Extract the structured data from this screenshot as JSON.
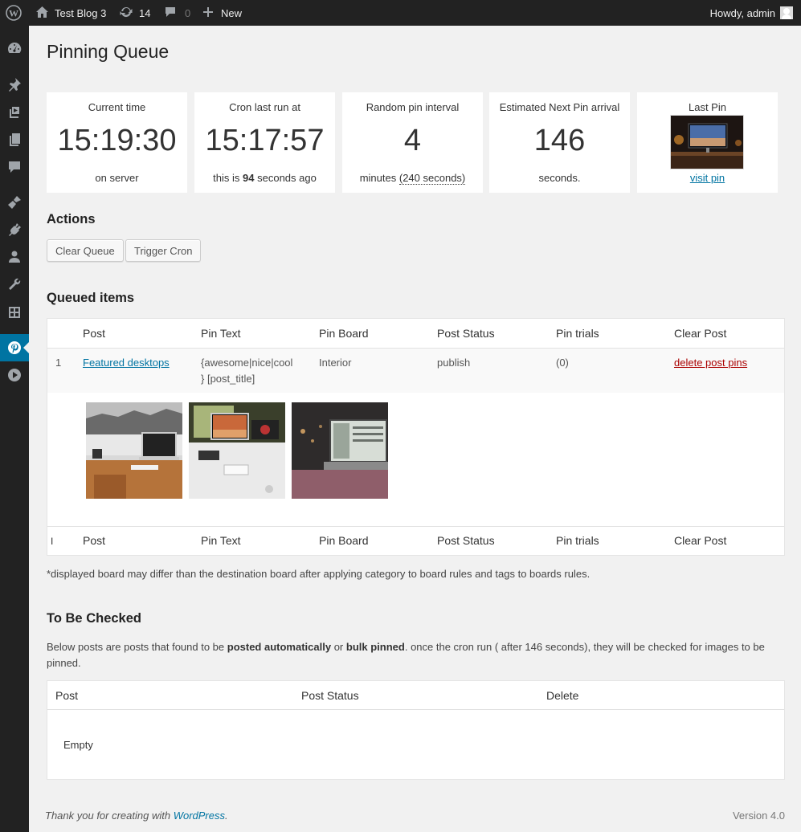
{
  "adminbar": {
    "site_name": "Test Blog 3",
    "updates_count": "14",
    "comments_count": "0",
    "new_label": "New",
    "howdy": "Howdy, admin"
  },
  "page": {
    "title": "Pinning Queue"
  },
  "stats": {
    "current_time": {
      "label": "Current time",
      "value": "15:19:30",
      "note": "on server"
    },
    "cron": {
      "label": "Cron last run at",
      "value": "15:17:57",
      "note_prefix": "this is",
      "note_seconds": "94",
      "note_suffix": "seconds ago"
    },
    "interval": {
      "label": "Random pin interval",
      "value": "4",
      "note_prefix": "minutes",
      "note_abbr": "(240 seconds)"
    },
    "next_pin": {
      "label": "Estimated Next Pin arrival",
      "value": "146",
      "note": "seconds."
    },
    "last_pin": {
      "label": "Last Pin",
      "link": "visit pin"
    }
  },
  "actions": {
    "heading": "Actions",
    "clear_queue": "Clear Queue",
    "trigger_cron": "Trigger Cron"
  },
  "queue": {
    "heading": "Queued items",
    "columns": [
      "Post",
      "Pin Text",
      "Pin Board",
      "Post Status",
      "Pin trials",
      "Clear Post"
    ],
    "row": {
      "num": "1",
      "post": "Featured desktops",
      "pin_text_1": "{awesome|nice|cool",
      "pin_text_2": "} [post_title]",
      "board": "Interior",
      "status": "publish",
      "trials": "(0)",
      "clear": "delete post pins"
    },
    "footer_marker": "I",
    "footnote": "*displayed board may differ than the destination board after applying category to board rules and tags to boards rules."
  },
  "checked": {
    "heading": "To Be Checked",
    "desc_1": "Below posts are posts that found to be",
    "desc_bold_1": "posted automatically",
    "desc_2": "or",
    "desc_bold_2": "bulk pinned",
    "desc_3": ". once the cron run ( after 146 seconds), they will be checked for images to be pinned.",
    "columns": [
      "Post",
      "Post Status",
      "Delete"
    ],
    "empty": "Empty"
  },
  "footer": {
    "thanks": "Thank you for creating with",
    "wp_link": "WordPress",
    "period": ".",
    "version": "Version 4.0"
  },
  "colors": {
    "adminbar": "#222222",
    "accent": "#0074a2",
    "background": "#f1f1f1",
    "delete": "#aa0000"
  }
}
